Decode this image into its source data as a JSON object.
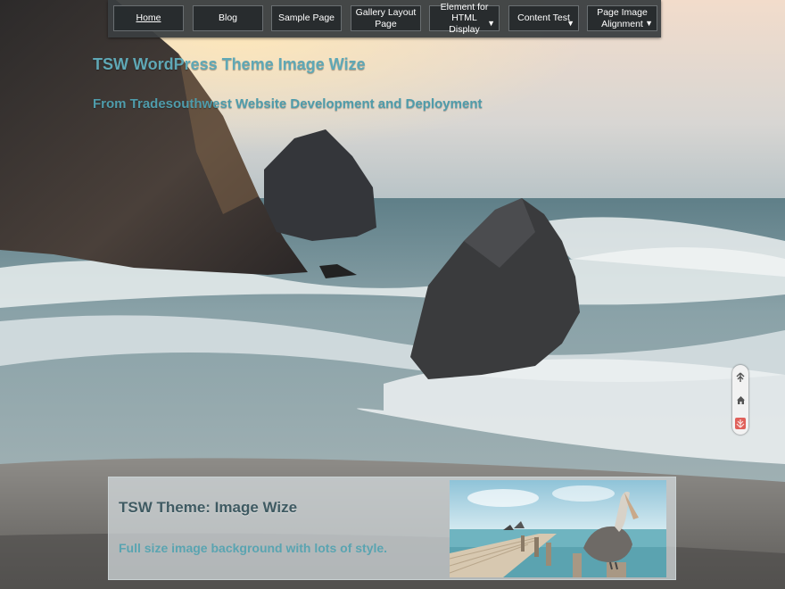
{
  "nav": {
    "items": [
      {
        "label": "Home",
        "active": true,
        "has_submenu": false
      },
      {
        "label": "Blog",
        "active": false,
        "has_submenu": false
      },
      {
        "label": "Sample Page",
        "active": false,
        "has_submenu": false
      },
      {
        "label": "Gallery Layout\nPage",
        "active": false,
        "has_submenu": false
      },
      {
        "label": "Element for HTML\nDisplay",
        "active": false,
        "has_submenu": true
      },
      {
        "label": "Content Test",
        "active": false,
        "has_submenu": true
      },
      {
        "label": "Page Image\nAlignment",
        "active": false,
        "has_submenu": true
      }
    ],
    "submenu_glyph": "▼"
  },
  "header": {
    "site_title": "TSW WordPress Theme Image Wize",
    "tagline": "From Tradesouthwest Website Development and Deployment"
  },
  "feature": {
    "title": "TSW Theme: Image Wize",
    "subtitle": "Full size image background with lots of style."
  },
  "scroll_widget": {
    "buttons": [
      {
        "icon": "double-up-arrow-icon",
        "glyph": "⇈"
      },
      {
        "icon": "home-icon",
        "glyph": "⌂"
      },
      {
        "icon": "double-down-arrow-icon",
        "glyph": "⇊"
      }
    ]
  },
  "colors": {
    "title_teal": "#5fa8b6",
    "tagline_teal": "#4f9cab",
    "nav_bg": "#3a3e40",
    "feature_title": "#3f5a62"
  }
}
